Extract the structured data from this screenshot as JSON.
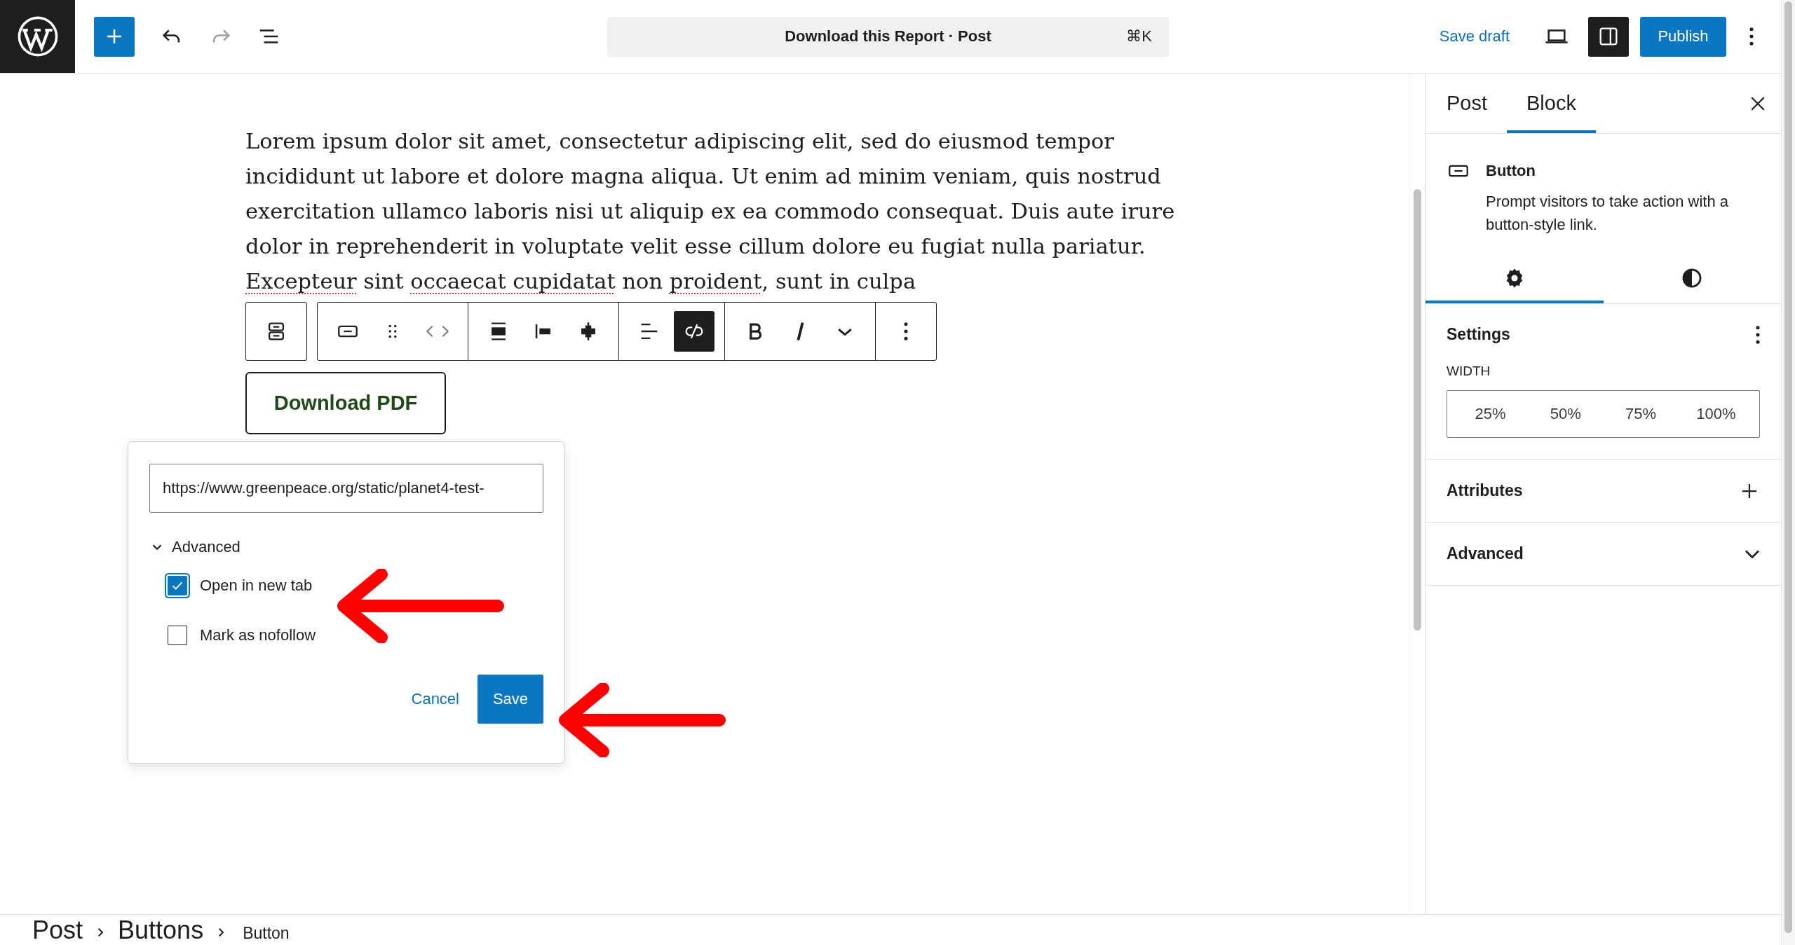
{
  "top_bar": {
    "undo": {
      "disabled": false
    },
    "redo": {
      "disabled": true
    },
    "command_bar": {
      "title": "Download this Report · Post",
      "shortcut": "⌘K"
    },
    "save_draft": "Save draft",
    "settings_toggle": {
      "pressed": true
    },
    "publish": "Publish"
  },
  "editor": {
    "paragraph": [
      {
        "text": "Lorem ipsum dolor sit amet, consectetur adipiscing elit, sed do eiusmod tempor incididunt ut labore et dolore magna aliqua. Ut enim ad minim veniam, quis nostrud exercitation ullamco laboris nisi ut aliquip ex ea commodo consequat. Duis aute irure dolor in reprehenderit in voluptate velit esse cillum dolore eu fugiat nulla pariatur. ",
        "misspelled": false
      },
      {
        "text": "Excepteur",
        "misspelled": true
      },
      {
        "text": " sint ",
        "misspelled": false
      },
      {
        "text": "occaecat cupidatat",
        "misspelled": true
      },
      {
        "text": " non ",
        "misspelled": false
      },
      {
        "text": "proident",
        "misspelled": true
      },
      {
        "text": ", sunt in culpa",
        "misspelled": false
      }
    ],
    "block_toolbar": [
      [
        {
          "kind": "buttons",
          "pressed": false
        }
      ],
      [
        {
          "kind": "button",
          "pressed": false
        },
        {
          "kind": "drag",
          "pressed": false
        },
        {
          "kind": "move",
          "pressed": false
        }
      ],
      [
        {
          "kind": "wide",
          "pressed": false
        },
        {
          "kind": "justify_left",
          "pressed": false
        },
        {
          "kind": "justify_center",
          "pressed": false
        }
      ],
      [
        {
          "kind": "text_align",
          "pressed": false
        },
        {
          "kind": "unlink",
          "pressed": true
        }
      ],
      [
        {
          "kind": "bold",
          "pressed": false
        },
        {
          "kind": "italic",
          "pressed": false
        },
        {
          "kind": "more",
          "pressed": false
        }
      ],
      [
        {
          "kind": "options",
          "pressed": false
        }
      ]
    ],
    "button_block": "Download PDF",
    "link_popover": {
      "url": "https://www.greenpeace.org/static/planet4-test-",
      "advanced": {
        "label": "Advanced",
        "expanded": true
      },
      "options": [
        {
          "label": "Open in new tab",
          "checked": true
        },
        {
          "label": "Mark as nofollow",
          "checked": false
        }
      ],
      "cancel": "Cancel",
      "save": "Save"
    }
  },
  "sidebar": {
    "tabs": [
      {
        "label": "Post",
        "selected": false
      },
      {
        "label": "Block",
        "selected": true
      }
    ],
    "block_card": {
      "title": "Button",
      "description": "Prompt visitors to take action with a button-style link."
    },
    "inspector_tabs": [
      {
        "kind": "settings",
        "selected": true
      },
      {
        "kind": "styles",
        "selected": false
      }
    ],
    "settings": {
      "title": "Settings",
      "width_label": "WIDTH",
      "width_options": [
        {
          "label": "25%",
          "selected": false
        },
        {
          "label": "50%",
          "selected": false
        },
        {
          "label": "75%",
          "selected": false
        },
        {
          "label": "100%",
          "selected": false
        }
      ]
    },
    "panels": [
      {
        "title": "Attributes",
        "kind": "add"
      },
      {
        "title": "Advanced",
        "kind": "collapse"
      }
    ]
  },
  "breadcrumbs": [
    "Post",
    "Buttons",
    "Button"
  ]
}
